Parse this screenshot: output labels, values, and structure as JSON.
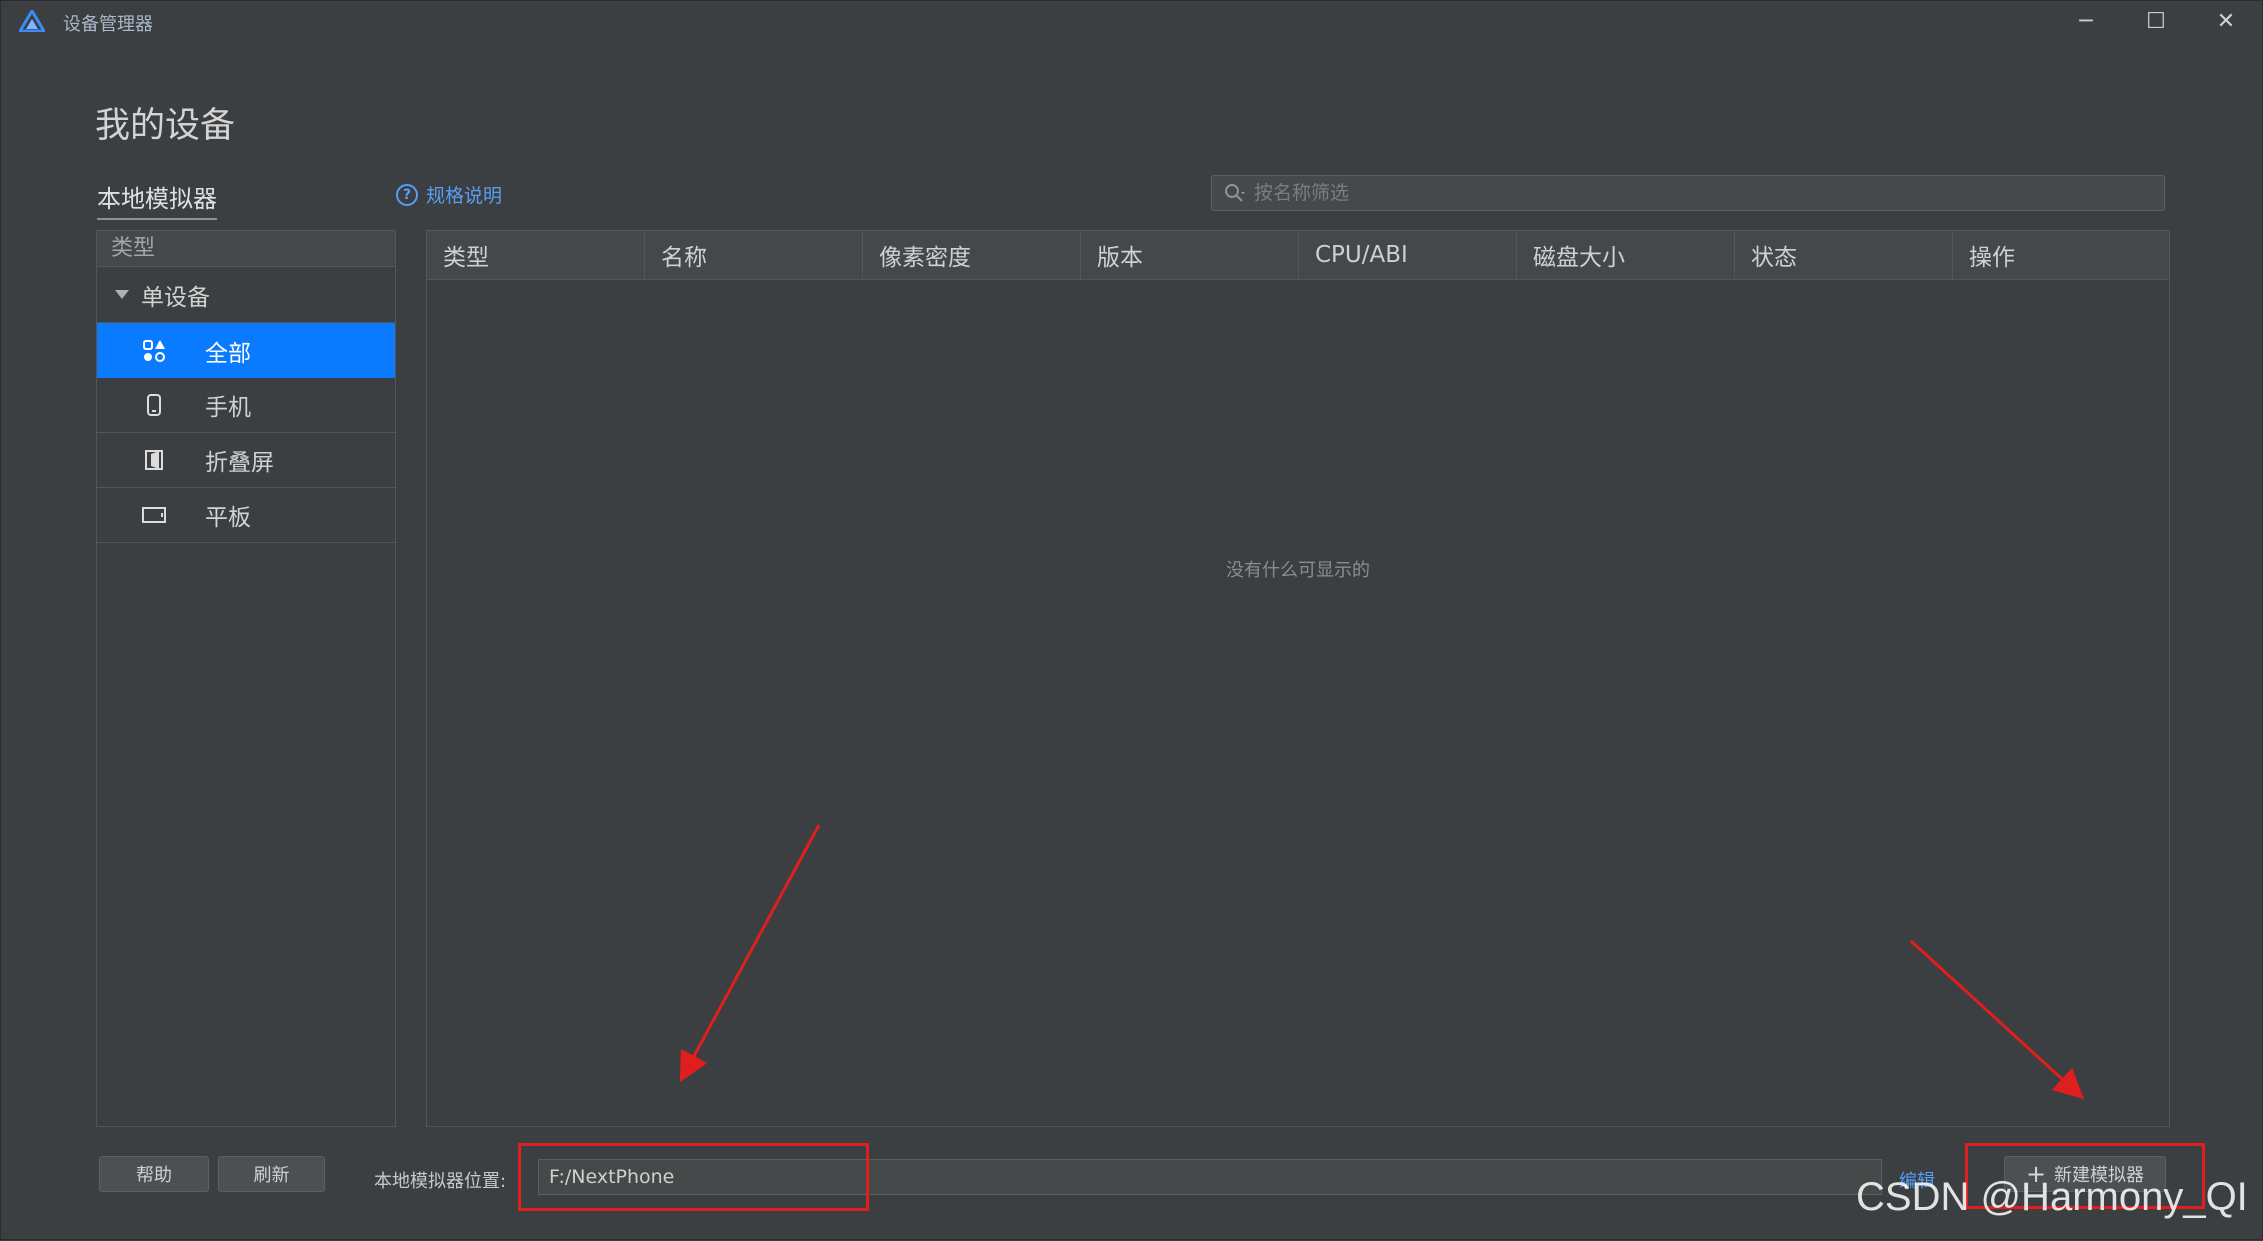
{
  "window": {
    "title": "设备管理器",
    "controls": {
      "minimize": "─",
      "maximize": "☐",
      "close": "✕"
    }
  },
  "page": {
    "title": "我的设备",
    "section_tab": "本地模拟器",
    "spec_link": "规格说明",
    "search_placeholder": "按名称筛选"
  },
  "sidebar": {
    "header": "类型",
    "group": "单设备",
    "items": [
      {
        "label": "全部",
        "icon": "grid-shapes-icon",
        "active": true
      },
      {
        "label": "手机",
        "icon": "phone-icon",
        "active": false
      },
      {
        "label": "折叠屏",
        "icon": "foldable-icon",
        "active": false
      },
      {
        "label": "平板",
        "icon": "tablet-icon",
        "active": false
      }
    ]
  },
  "table": {
    "columns": [
      "类型",
      "名称",
      "像素密度",
      "版本",
      "CPU/ABI",
      "磁盘大小",
      "状态",
      "操作"
    ],
    "rows": [],
    "empty_text": "没有什么可显示的"
  },
  "footer": {
    "help_button": "帮助",
    "refresh_button": "刷新",
    "location_label": "本地模拟器位置:",
    "location_value": "F:/NextPhone",
    "edit_link": "编辑",
    "new_emulator_button": "新建模拟器"
  },
  "watermark": "CSDN @Harmony_QI",
  "colors": {
    "background": "#3c3f41",
    "active_item": "#0a7bff",
    "link": "#589df6",
    "annotation": "#e01e1e"
  }
}
